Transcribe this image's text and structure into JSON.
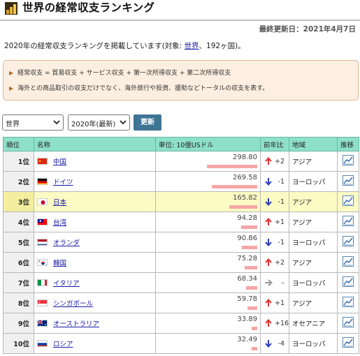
{
  "page": {
    "title": "世界の経常収支ランキング",
    "updated": "最終更新日：2021年4月7日",
    "description_prefix": "2020年の経常収支ランキングを掲載しています(対象: ",
    "description_link": "世界",
    "description_suffix": "、192ヶ国)。"
  },
  "notes": [
    "経常収支 = 貿易収支 + サービス収支 + 第一次所得収支 + 第二次所得収支",
    "海外との商品取引の収支だけでなく、海外旅行や投資、援助などトータルの収支を表す。"
  ],
  "controls": {
    "region_select": "世界",
    "year_select": "2020年(最新)",
    "update_button": "更新"
  },
  "table": {
    "headers": {
      "rank": "順位",
      "name": "名称",
      "value": "単位: 10億USドル",
      "change": "前年比",
      "region": "地域",
      "trend": "推移"
    },
    "max_value": 298.8,
    "rows": [
      {
        "rank": "1位",
        "name": "中国",
        "value": "298.80",
        "value_num": 298.8,
        "direction": "up",
        "change": "+2",
        "region": "アジア",
        "flag": "china"
      },
      {
        "rank": "2位",
        "name": "ドイツ",
        "value": "269.58",
        "value_num": 269.58,
        "direction": "down",
        "change": "-1",
        "region": "ヨーロッパ",
        "flag": "germany"
      },
      {
        "rank": "3位",
        "name": "日本",
        "value": "165.82",
        "value_num": 165.82,
        "direction": "down",
        "change": "-1",
        "region": "アジア",
        "flag": "japan",
        "highlight": true
      },
      {
        "rank": "4位",
        "name": "台湾",
        "value": "94.28",
        "value_num": 94.28,
        "direction": "up",
        "change": "+1",
        "region": "アジア",
        "flag": "taiwan"
      },
      {
        "rank": "5位",
        "name": "オランダ",
        "value": "90.86",
        "value_num": 90.86,
        "direction": "down",
        "change": "-1",
        "region": "ヨーロッパ",
        "flag": "netherlands"
      },
      {
        "rank": "6位",
        "name": "韓国",
        "value": "75.28",
        "value_num": 75.28,
        "direction": "up",
        "change": "+2",
        "region": "アジア",
        "flag": "korea"
      },
      {
        "rank": "7位",
        "name": "イタリア",
        "value": "68.34",
        "value_num": 68.34,
        "direction": "same",
        "change": "–",
        "region": "ヨーロッパ",
        "flag": "italy"
      },
      {
        "rank": "8位",
        "name": "シンガポール",
        "value": "59.78",
        "value_num": 59.78,
        "direction": "up",
        "change": "+1",
        "region": "アジア",
        "flag": "singapore"
      },
      {
        "rank": "9位",
        "name": "オーストラリア",
        "value": "33.89",
        "value_num": 33.89,
        "direction": "up",
        "change": "+16",
        "region": "オセアニア",
        "flag": "australia"
      },
      {
        "rank": "10位",
        "name": "ロシア",
        "value": "32.49",
        "value_num": 32.49,
        "direction": "down",
        "change": "-4",
        "region": "ヨーロッパ",
        "flag": "russia"
      }
    ]
  },
  "colors": {
    "header_bg": "#8ee0c9",
    "highlight_row": "#fdfbc4",
    "bar": "#f6a6a6",
    "arrow_up": "#e03030",
    "arrow_down": "#2a3bb8",
    "arrow_same": "#999999",
    "button": "#3e7494"
  },
  "icons": {
    "logo": "gold-bars-icon",
    "trend": "line-chart-icon",
    "bullet": "triangle-bullet-icon"
  }
}
